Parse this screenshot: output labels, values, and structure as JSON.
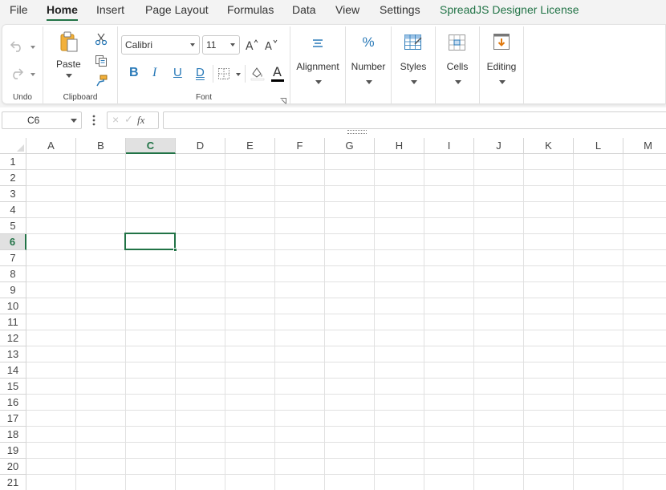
{
  "menu": {
    "items": [
      {
        "label": "File",
        "active": false
      },
      {
        "label": "Home",
        "active": true
      },
      {
        "label": "Insert",
        "active": false
      },
      {
        "label": "Page Layout",
        "active": false
      },
      {
        "label": "Formulas",
        "active": false
      },
      {
        "label": "Data",
        "active": false
      },
      {
        "label": "View",
        "active": false
      },
      {
        "label": "Settings",
        "active": false
      }
    ],
    "license_label": "SpreadJS Designer License"
  },
  "ribbon": {
    "undo": {
      "group_label": "Undo",
      "undo_icon": "undo-icon",
      "redo_icon": "redo-icon"
    },
    "clipboard": {
      "group_label": "Clipboard",
      "paste_label": "Paste",
      "paste_icon": "paste-icon",
      "cut_icon": "cut-icon",
      "copy_icon": "copy-icon",
      "format_painter_icon": "format-painter-icon"
    },
    "font": {
      "group_label": "Font",
      "font_name": "Calibri",
      "font_size": "11",
      "bold": "B",
      "italic": "I",
      "underline": "U",
      "double_underline": "D",
      "font_color_glyph": "A",
      "increase_size_icon": "increase-font-size-icon",
      "decrease_size_icon": "decrease-font-size-icon"
    },
    "alignment": {
      "label": "Alignment",
      "icon": "alignment-icon"
    },
    "number": {
      "label": "Number",
      "glyph": "%"
    },
    "styles": {
      "label": "Styles",
      "icon": "styles-icon"
    },
    "cells": {
      "label": "Cells",
      "icon": "cells-icon"
    },
    "editing": {
      "label": "Editing",
      "icon": "editing-icon"
    }
  },
  "formula_bar": {
    "name_box": "C6",
    "cancel_glyph": "×",
    "enter_glyph": "✓",
    "fx_glyph": "fx",
    "formula": ""
  },
  "sheet": {
    "columns": [
      "A",
      "B",
      "C",
      "D",
      "E",
      "F",
      "G",
      "H",
      "I",
      "J",
      "K",
      "L",
      "M"
    ],
    "rows": [
      "1",
      "2",
      "3",
      "4",
      "5",
      "6",
      "7",
      "8",
      "9",
      "10",
      "11",
      "12",
      "13",
      "14",
      "15",
      "16",
      "17",
      "18",
      "19",
      "20",
      "21"
    ],
    "selected_column": "C",
    "selected_row": "6"
  },
  "colors": {
    "accent": "#217346",
    "icon_blue": "#2a7ab8",
    "icon_orange": "#e07a10"
  }
}
